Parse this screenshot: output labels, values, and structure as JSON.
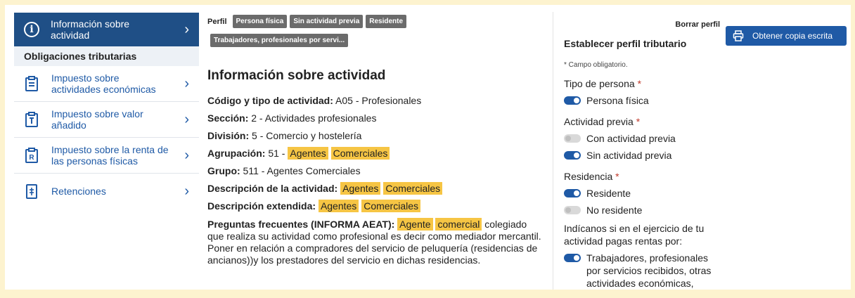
{
  "sidebar": {
    "active_item": {
      "label": "Información sobre actividad",
      "icon": "info-icon"
    },
    "section_title": "Obligaciones tributarias",
    "items": [
      {
        "label": "Impuesto sobre actividades económicas",
        "icon": "clipboard-icon"
      },
      {
        "label": "Impuesto sobre valor añadido",
        "icon": "percent-document-icon"
      },
      {
        "label": "Impuesto sobre la renta de las personas físicas",
        "icon": "r-document-icon"
      },
      {
        "label": "Retenciones",
        "icon": "euro-document-icon"
      }
    ]
  },
  "perfil": {
    "label": "Perfil",
    "badges": [
      "Persona física",
      "Sin actividad previa",
      "Residente",
      "Trabajadores, profesionales por servi..."
    ]
  },
  "content": {
    "title": "Información sobre actividad",
    "codigo_label": "Código y tipo de actividad:",
    "codigo_value": "A05 - Profesionales",
    "seccion_label": "Sección:",
    "seccion_value": "2 - Actividades profesionales",
    "division_label": "División:",
    "division_value": "5 - Comercio y hostelería",
    "agrupacion_label": "Agrupación:",
    "agrupacion_value": "51 -",
    "hl_agentes": "Agentes",
    "hl_comerciales": "Comerciales",
    "grupo_label": "Grupo:",
    "grupo_value": "511 - Agentes Comerciales",
    "descripcion_label": "Descripción de la actividad:",
    "descripcion_ext_label": "Descripción extendida:",
    "faq_label": "Preguntas frecuentes (INFORMA AEAT):",
    "faq_hl1": "Agente",
    "faq_hl2": "comercial",
    "faq_text": "colegiado que realiza su actividad como profesional es decir como mediador mercantil. Poner en relación a compradores del servicio de peluquería (residencias de ancianos))y los prestadores del servicio en dichas residencias."
  },
  "right": {
    "borrar": "Borrar perfil",
    "title": "Establecer perfil tributario",
    "obligatorio": "* Campo obligatorio.",
    "tipo_persona_label": "Tipo de persona",
    "persona_fisica": "Persona física",
    "actividad_previa_label": "Actividad previa",
    "con_actividad": "Con actividad previa",
    "sin_actividad": "Sin actividad previa",
    "residencia_label": "Residencia",
    "residente": "Residente",
    "no_residente": "No residente",
    "indicanos": "Indícanos si en el ejercicio de tu actividad pagas rentas por:",
    "trabajadores": "Trabajadores, profesionales por servicios recibidos, otras actividades económicas,",
    "asterisk": "*"
  },
  "copy_button": {
    "label": "Obtener copia escrita",
    "icon": "printer-icon"
  },
  "colors": {
    "primary": "#1f4f86",
    "link": "#1f5aa6",
    "highlight": "#f6c544",
    "badge": "#6b6b6b",
    "frame": "#fdf3cf"
  }
}
